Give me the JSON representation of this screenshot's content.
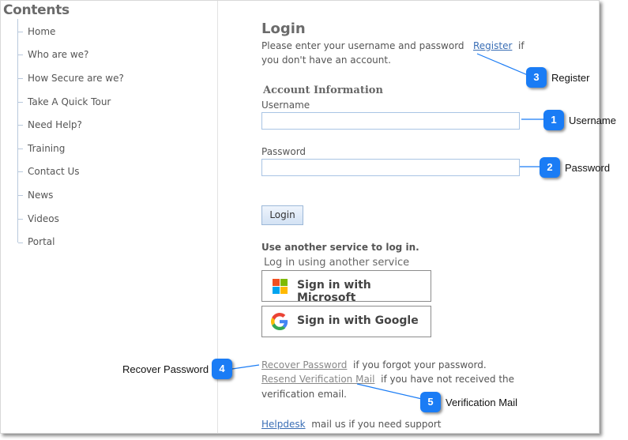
{
  "sidebar": {
    "title": "Contents",
    "items": [
      {
        "label": "Home"
      },
      {
        "label": "Who are we?"
      },
      {
        "label": "How Secure are we?"
      },
      {
        "label": "Take A Quick Tour"
      },
      {
        "label": "Need Help?"
      },
      {
        "label": "Training"
      },
      {
        "label": "Contact Us"
      },
      {
        "label": "News"
      },
      {
        "label": "Videos"
      },
      {
        "label": "Portal"
      }
    ]
  },
  "login": {
    "title": "Login",
    "intro_text": "Please enter your username and password",
    "register_link": "Register",
    "intro_suffix": "if",
    "intro_line2": "you don't have an account.",
    "account_heading": "Account Information",
    "username_label": "Username",
    "username_value": "",
    "password_label": "Password",
    "password_value": "",
    "login_button": "Login"
  },
  "external": {
    "heading": "Use another service to log in.",
    "subheading": "Log in using another service",
    "microsoft_button": "Sign in with Microsoft",
    "google_button": "Sign in with Google"
  },
  "footer_links": {
    "recover_link": "Recover Password",
    "recover_text": "if you forgot your password.",
    "resend_link": "Resend Verification Mail",
    "resend_text": "if you have not received the",
    "resend_text2": "verification email.",
    "helpdesk_link": "Helpdesk",
    "helpdesk_text": "mail us if you need support"
  },
  "callouts": [
    {
      "number": "1",
      "label": "Username"
    },
    {
      "number": "2",
      "label": "Password"
    },
    {
      "number": "3",
      "label": "Register"
    },
    {
      "number": "4",
      "label": "Recover Password"
    },
    {
      "number": "5",
      "label": "Verification Mail"
    }
  ],
  "colors": {
    "badge": "#1a7cf5",
    "link": "#3a6eb5",
    "input_border": "#a9c4e4"
  }
}
